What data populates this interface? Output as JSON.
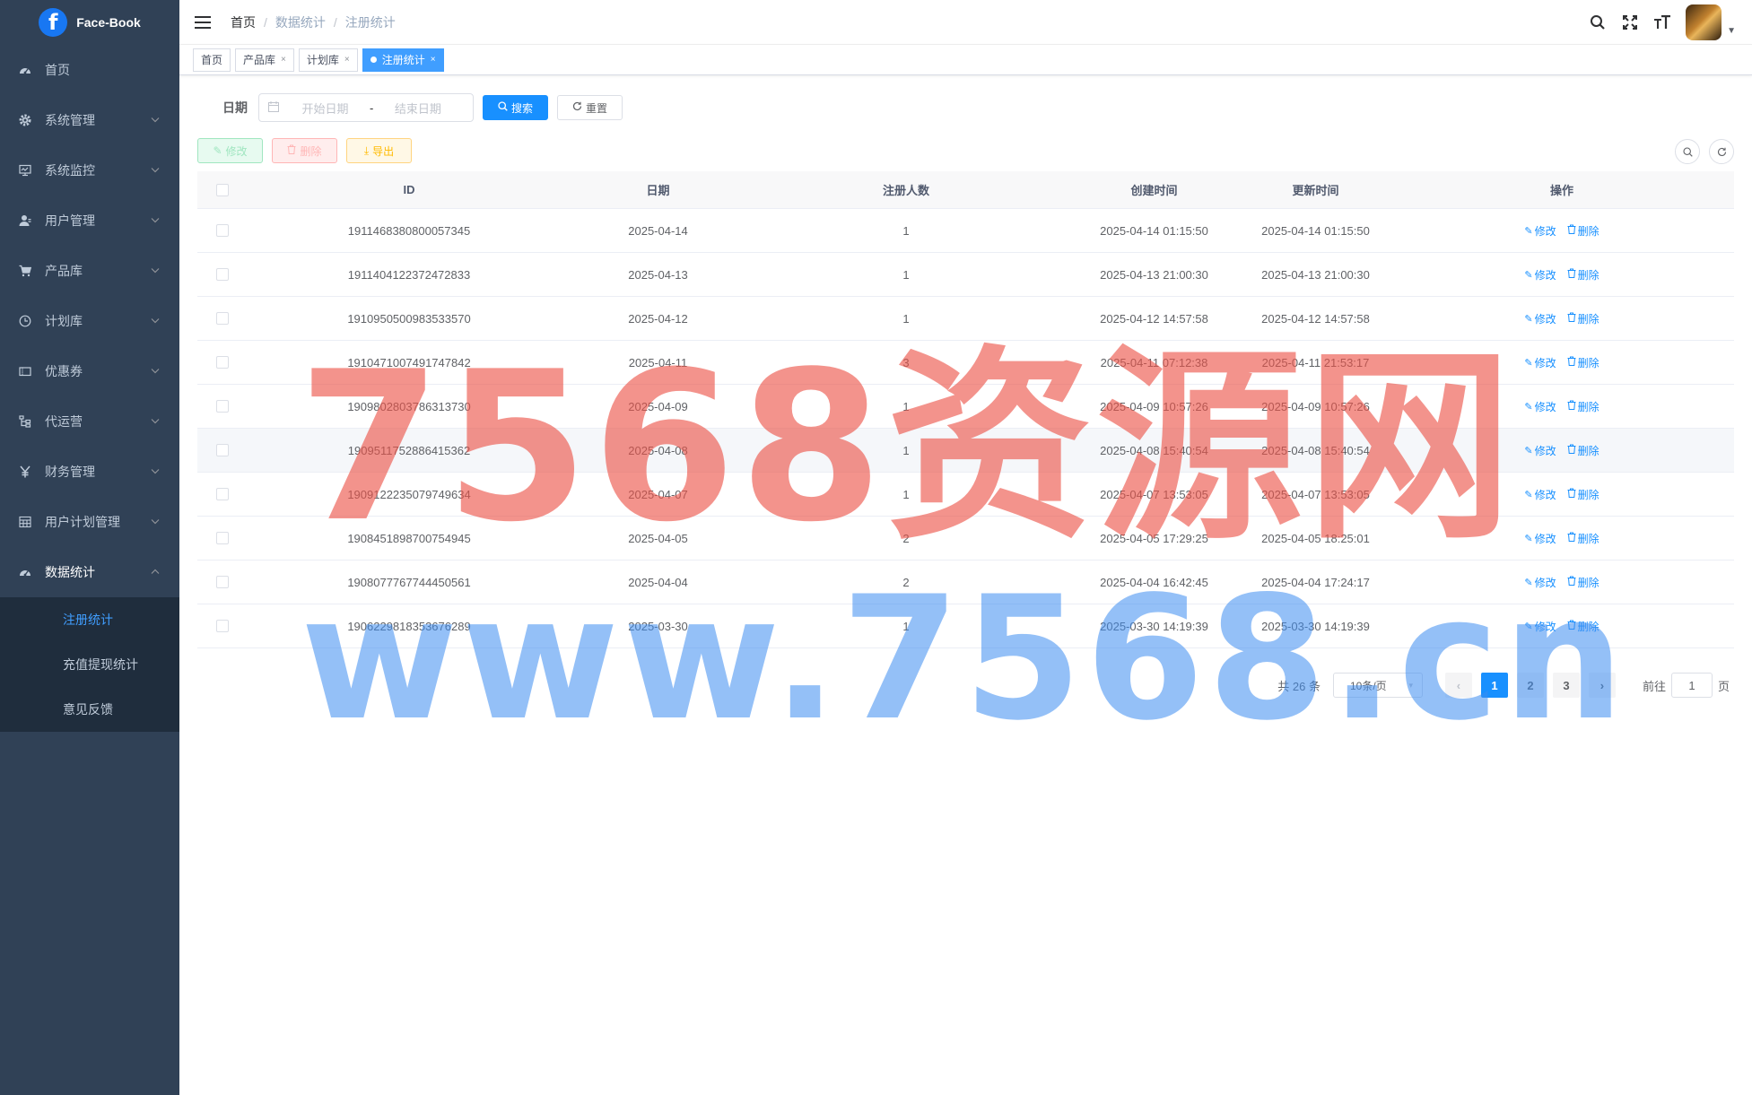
{
  "app": {
    "logo_letter": "f",
    "name": "Face-Book"
  },
  "sidebar": {
    "items": [
      {
        "label": "首页",
        "icon": "dashboard-icon"
      },
      {
        "label": "系统管理",
        "icon": "gear-icon"
      },
      {
        "label": "系统监控",
        "icon": "monitor-icon"
      },
      {
        "label": "用户管理",
        "icon": "user-icon"
      },
      {
        "label": "产品库",
        "icon": "cart-icon"
      },
      {
        "label": "计划库",
        "icon": "clock-icon"
      },
      {
        "label": "优惠券",
        "icon": "coupon-icon"
      },
      {
        "label": "代运营",
        "icon": "tree-icon"
      },
      {
        "label": "财务管理",
        "icon": "yen-icon"
      },
      {
        "label": "用户计划管理",
        "icon": "grid-icon"
      },
      {
        "label": "数据统计",
        "icon": "dashboard-icon"
      }
    ],
    "subitems": [
      {
        "label": "注册统计",
        "active": true
      },
      {
        "label": "充值提现统计",
        "active": false
      },
      {
        "label": "意见反馈",
        "active": false
      }
    ]
  },
  "navbar": {
    "breadcrumb": [
      "首页",
      "数据统计",
      "注册统计"
    ],
    "separator": "/"
  },
  "tags": [
    {
      "label": "首页",
      "closable": false,
      "active": false
    },
    {
      "label": "产品库",
      "closable": true,
      "active": false
    },
    {
      "label": "计划库",
      "closable": true,
      "active": false
    },
    {
      "label": "注册统计",
      "closable": true,
      "active": true
    }
  ],
  "search": {
    "date_label": "日期",
    "start_placeholder": "开始日期",
    "range_separator": "-",
    "end_placeholder": "结束日期",
    "search_button": "搜索",
    "reset_button": "重置"
  },
  "toolbar": {
    "edit_label": "修改",
    "delete_label": "删除",
    "export_label": "导出"
  },
  "table": {
    "columns": [
      "ID",
      "日期",
      "注册人数",
      "创建时间",
      "更新时间",
      "操作"
    ],
    "edit_op": "修改",
    "delete_op": "删除",
    "rows": [
      {
        "id": "1911468380800057345",
        "date": "2025-04-14",
        "count": "1",
        "created": "2025-04-14 01:15:50",
        "updated": "2025-04-14 01:15:50"
      },
      {
        "id": "1911404122372472833",
        "date": "2025-04-13",
        "count": "1",
        "created": "2025-04-13 21:00:30",
        "updated": "2025-04-13 21:00:30"
      },
      {
        "id": "1910950500983533570",
        "date": "2025-04-12",
        "count": "1",
        "created": "2025-04-12 14:57:58",
        "updated": "2025-04-12 14:57:58"
      },
      {
        "id": "1910471007491747842",
        "date": "2025-04-11",
        "count": "3",
        "created": "2025-04-11 07:12:38",
        "updated": "2025-04-11 21:53:17"
      },
      {
        "id": "1909802803786313730",
        "date": "2025-04-09",
        "count": "1",
        "created": "2025-04-09 10:57:26",
        "updated": "2025-04-09 10:57:26"
      },
      {
        "id": "1909511752886415362",
        "date": "2025-04-08",
        "count": "1",
        "created": "2025-04-08 15:40:54",
        "updated": "2025-04-08 15:40:54"
      },
      {
        "id": "1909122235079749634",
        "date": "2025-04-07",
        "count": "1",
        "created": "2025-04-07 13:53:05",
        "updated": "2025-04-07 13:53:05"
      },
      {
        "id": "1908451898700754945",
        "date": "2025-04-05",
        "count": "2",
        "created": "2025-04-05 17:29:25",
        "updated": "2025-04-05 18:25:01"
      },
      {
        "id": "1908077767744450561",
        "date": "2025-04-04",
        "count": "2",
        "created": "2025-04-04 16:42:45",
        "updated": "2025-04-04 17:24:17"
      },
      {
        "id": "1906229818353676289",
        "date": "2025-03-30",
        "count": "1",
        "created": "2025-03-30 14:19:39",
        "updated": "2025-03-30 14:19:39"
      }
    ]
  },
  "pagination": {
    "total_text": "共 26 条",
    "page_size": "10条/页",
    "pages": [
      "1",
      "2",
      "3"
    ],
    "current": "1",
    "goto_prefix": "前往",
    "goto_value": "1",
    "goto_suffix": "页"
  },
  "watermark": {
    "line1": "7568资源网",
    "line2": "www.7568.cn"
  },
  "colors": {
    "sidebar_bg": "#304156",
    "primary": "#1890ff",
    "active_submenu": "#409eff"
  }
}
